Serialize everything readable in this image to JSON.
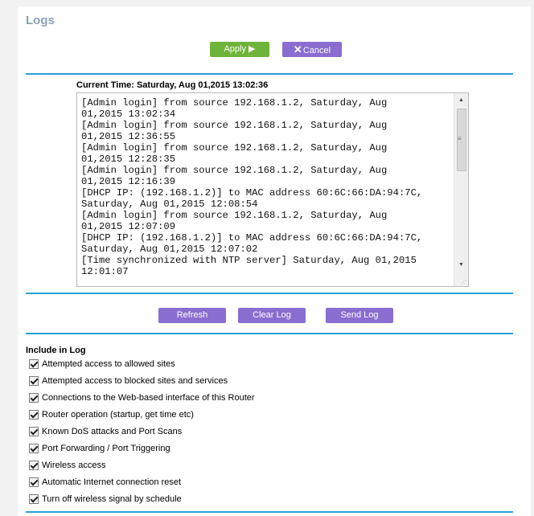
{
  "page": {
    "title": "Logs"
  },
  "toolbar": {
    "apply_label": "Apply ▶",
    "cancel_label": "Cancel"
  },
  "current_time": "Current Time: Saturday, Aug 01,2015 13:02:36",
  "log": {
    "text": "[Admin login] from source 192.168.1.2, Saturday, Aug\n01,2015 13:02:34\n[Admin login] from source 192.168.1.2, Saturday, Aug\n01,2015 12:36:55\n[Admin login] from source 192.168.1.2, Saturday, Aug\n01,2015 12:28:35\n[Admin login] from source 192.168.1.2, Saturday, Aug\n01,2015 12:16:39\n[DHCP IP: (192.168.1.2)] to MAC address 60:6C:66:DA:94:7C,\nSaturday, Aug 01,2015 12:08:54\n[Admin login] from source 192.168.1.2, Saturday, Aug\n01,2015 12:07:09\n[DHCP IP: (192.168.1.2)] to MAC address 60:6C:66:DA:94:7C,\nSaturday, Aug 01,2015 12:07:02\n[Time synchronized with NTP server] Saturday, Aug 01,2015\n12:01:07"
  },
  "actions": {
    "refresh_label": "Refresh",
    "clear_label": "Clear Log",
    "send_label": "Send Log"
  },
  "include": {
    "heading": "Include in Log",
    "options": [
      {
        "label": "Attempted access to allowed sites",
        "checked": true
      },
      {
        "label": "Attempted access to blocked sites and services",
        "checked": true
      },
      {
        "label": "Connections to the Web-based interface of this Router",
        "checked": true
      },
      {
        "label": "Router operation (startup, get time etc)",
        "checked": true
      },
      {
        "label": "Known DoS attacks and Port Scans",
        "checked": true
      },
      {
        "label": "Port Forwarding / Port Triggering",
        "checked": true
      },
      {
        "label": "Wireless access",
        "checked": true
      },
      {
        "label": "Automatic Internet connection reset",
        "checked": true
      },
      {
        "label": "Turn off wireless signal by schedule",
        "checked": true
      }
    ]
  },
  "colors": {
    "accent_line": "#2aa0da",
    "apply": "#6fb43a",
    "purple_button": "#8a6dd0",
    "title": "#8a9fb8"
  }
}
